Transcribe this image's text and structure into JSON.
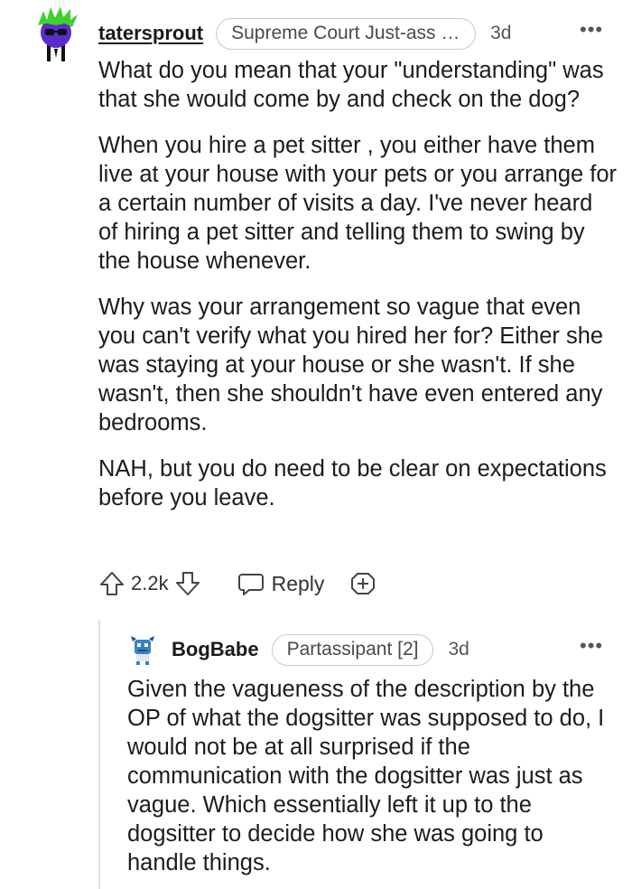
{
  "comment": {
    "username": "tatersprout",
    "flair": "Supreme Court Just-ass [1...",
    "time": "3d",
    "paragraphs": [
      "What do you mean that your \"understanding\" was that she would come by and check on the dog?",
      "When you hire a pet sitter , you either have them live at your house with your pets or you arrange for a certain number of visits a day. I've never heard of hiring a pet sitter and telling them to swing by the house whenever.",
      "Why was your arrangement so vague that even you can't verify what you hired her for? Either she was staying at your house or she wasn't. If she wasn't, then she shouldn't have even entered any bedrooms.",
      "NAH, but you do need to be clear on expectations before you leave."
    ],
    "votes": "2.2k",
    "reply_label": "Reply",
    "icons": {
      "upvote": "upvote-arrow-icon",
      "downvote": "downvote-arrow-icon",
      "reply": "speech-bubble-icon",
      "award": "plus-award-icon",
      "more": "more-dots-icon"
    }
  },
  "reply": {
    "username": "BogBabe",
    "flair": "Partassipant [2]",
    "time": "3d",
    "text": "Given the vagueness of the description by the OP of what the dogsitter was supposed to do, I would not be at all surprised if the communication with the dogsitter was just as vague. Which essentially left it up to the dogsitter to decide how she was going to handle things."
  },
  "colors": {
    "avatar1_body": "#5b2cc9",
    "avatar1_hair": "#3fd12f",
    "avatar2_body": "#3b82c4"
  }
}
